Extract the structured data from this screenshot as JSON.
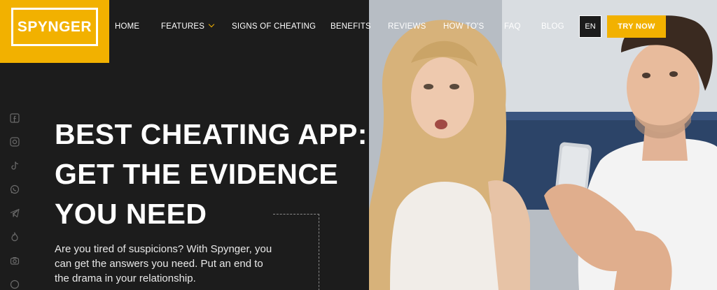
{
  "logo": {
    "text": "SPYNGER"
  },
  "nav": {
    "items": [
      {
        "id": "home",
        "label": "HOME"
      },
      {
        "id": "features",
        "label": "FEATURES"
      },
      {
        "id": "signs",
        "label": "SIGNS OF CHEATING"
      },
      {
        "id": "benefits",
        "label": "BENEFITS"
      },
      {
        "id": "reviews",
        "label": "REVIEWS"
      },
      {
        "id": "howtos",
        "label": "HOW TO'S"
      },
      {
        "id": "faq",
        "label": "FAQ"
      },
      {
        "id": "blog",
        "label": "BLOG"
      }
    ],
    "language": "EN",
    "cta": "TRY NOW"
  },
  "hero": {
    "headline": [
      "BEST CHEATING APP:",
      "GET THE EVIDENCE",
      "YOU NEED"
    ],
    "subtext": "Are you tired of suspicions? With Spynger, you can get the answers you need. Put an end to the drama in your relationship."
  },
  "social_icons": [
    "facebook-icon",
    "instagram-icon",
    "tiktok-icon",
    "whatsapp-icon",
    "telegram-icon",
    "tinder-icon",
    "camera-icon",
    "chat-icon"
  ],
  "colors": {
    "accent": "#f2b100",
    "background": "#1c1c1c",
    "text": "#ffffff"
  }
}
